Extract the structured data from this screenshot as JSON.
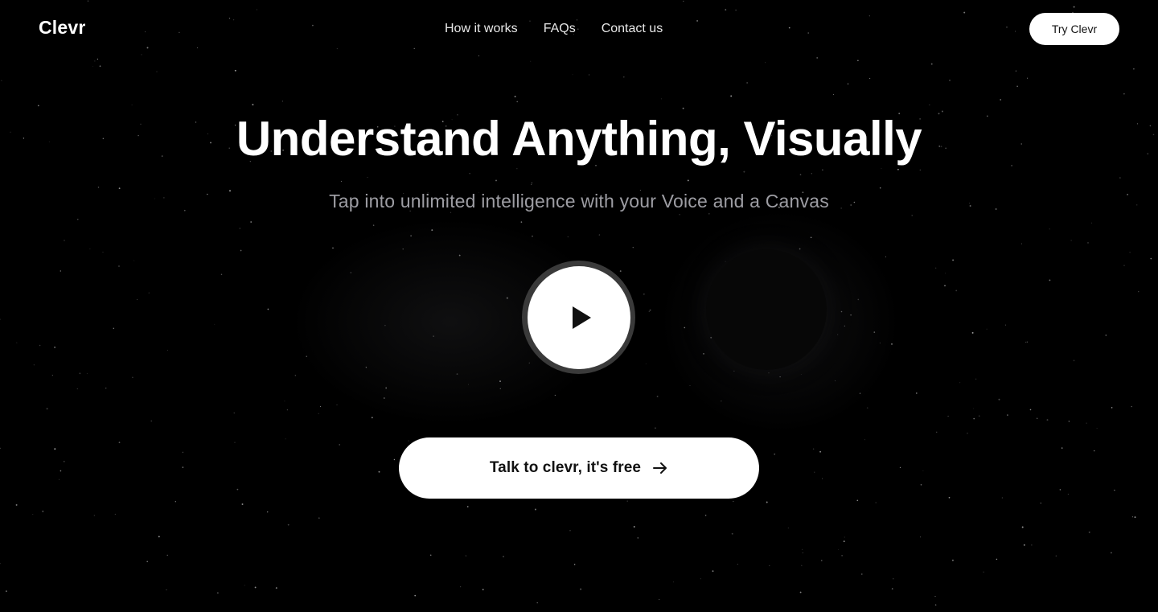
{
  "header": {
    "brand": "Clevr",
    "nav": [
      "How it works",
      "FAQs",
      "Contact us"
    ],
    "try_button": "Try Clevr"
  },
  "hero": {
    "title": "Understand Anything, Visually",
    "subtitle": "Tap into unlimited intelligence with your Voice and a Canvas",
    "play_icon": "play-icon",
    "cta_label": "Talk to clevr, it's free",
    "cta_icon": "arrow-right-icon"
  },
  "colors": {
    "background": "#000000",
    "text": "#ffffff",
    "subtitle": "#9d9da3",
    "button_bg": "#ffffff",
    "button_text": "#111111",
    "play_ring": "#3a3a3a"
  }
}
